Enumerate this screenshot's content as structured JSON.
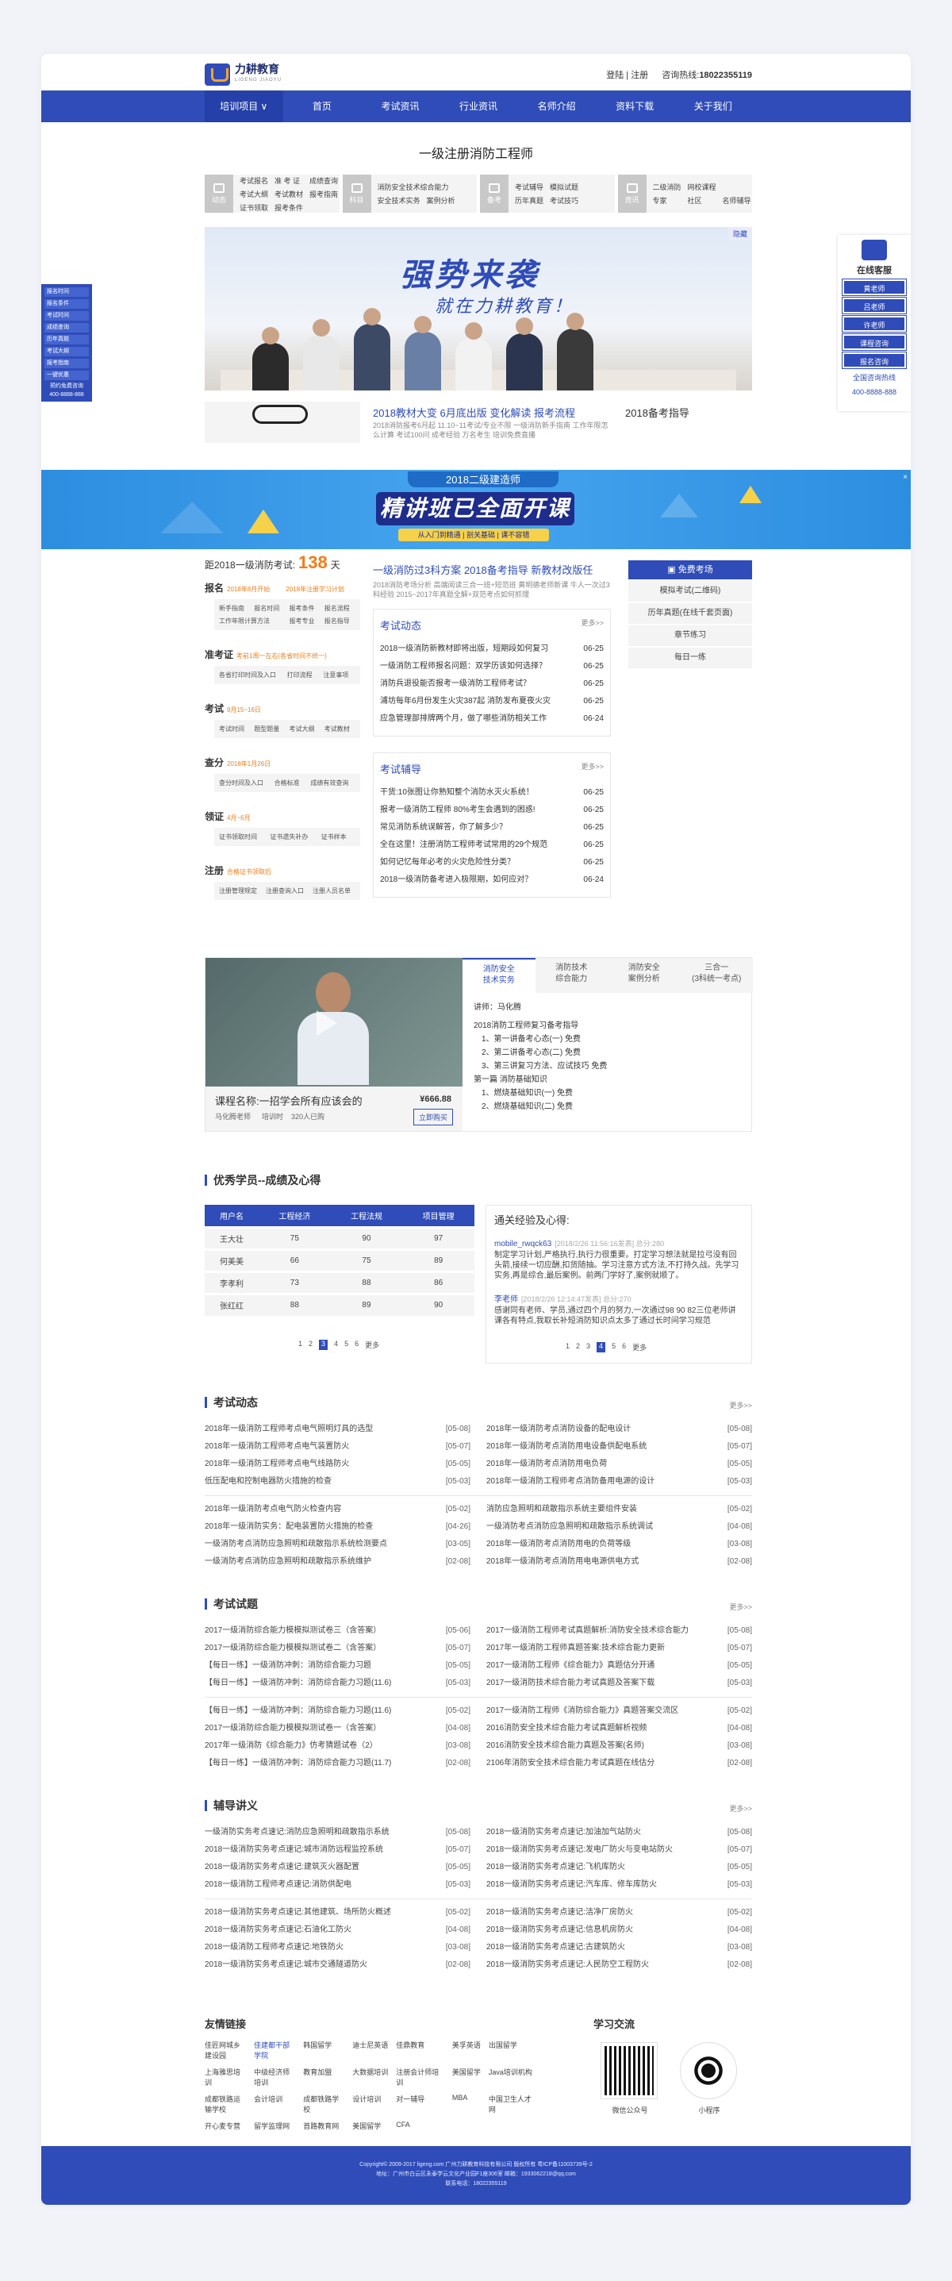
{
  "header": {
    "logo_text": "力耕教育",
    "logo_sub": "LIGENG JIAOYU",
    "login": "登陆",
    "sep": "|",
    "register": "注册",
    "hotline_label": "咨询热线:",
    "hotline": "18022355119"
  },
  "nav": [
    "培训项目 ∨",
    "首页",
    "考试资讯",
    "行业资讯",
    "名师介绍",
    "资料下载",
    "关于我们"
  ],
  "page_title": "一级注册消防工程师",
  "categories": [
    {
      "icon": "动态",
      "links": [
        "考试报名",
        "准 考 证",
        "成绩查询",
        "考试大纲",
        "考试教材",
        "报考指南",
        "证书领取",
        "报考条件"
      ]
    },
    {
      "icon": "科目",
      "links": [
        "消防安全技术综合能力",
        "安全技术实务",
        "案例分析"
      ]
    },
    {
      "icon": "备考",
      "links": [
        "考试辅导",
        "模拟试题",
        "历年真题",
        "考试技巧"
      ]
    },
    {
      "icon": "资讯",
      "links": [
        "二级消防",
        "网校课程",
        "专家",
        "社区",
        "名师辅导"
      ]
    }
  ],
  "hero": {
    "tag": "隐藏",
    "slogan1": "强势来袭",
    "slogan2": "就在力耕教育！"
  },
  "news": {
    "head": "2018教材大变 6月底出版 变化解读 报考流程",
    "sub": "2018消防报考6月起 11.10~11考试/专业不限 一级消防新手指南 工作年限怎么计算 考试100问 成考经验 万名考生 培训免费直播",
    "right_title": "2018备考指导"
  },
  "banner": {
    "top": "2018二级建造师",
    "main": "精讲班已全面开课",
    "sub": "从入门到精通 | 剖关基础 | 课不容错",
    "close": "×"
  },
  "left_float": {
    "items": [
      "报名时间",
      "报名条件",
      "考试时间",
      "成绩查询",
      "历年真题",
      "考试大纲",
      "报考指南",
      "一键优惠"
    ],
    "tel_label": "预约免费咨询",
    "tel": "400-8888-888"
  },
  "right_float": {
    "title": "在线客服",
    "buttons": [
      "黄老师",
      "吕老师",
      "许老师",
      "课程咨询",
      "报名咨询"
    ],
    "tel_label": "全国咨询热线",
    "tel": "400-8888-888"
  },
  "exam": {
    "countdown_prefix": "距2018一级消防考试:",
    "days": "138",
    "days_unit": "天",
    "steps": [
      {
        "title": "报名",
        "date": "2018年8月开始",
        "date2": "2018年注册学习计划",
        "links": [
          "新手指南",
          "报名时间",
          "报考条件",
          "报名流程",
          "工作年限计算方法",
          "报考专业",
          "报名指导"
        ]
      },
      {
        "title": "准考证",
        "date": "考前1周一左右(各省时间不统一)",
        "links": [
          "各省打印时间及入口",
          "打印流程",
          "注意事项"
        ]
      },
      {
        "title": "考试",
        "date": "9月15~16日",
        "links": [
          "考试时间",
          "题型题量",
          "考试大纲",
          "考试教材"
        ]
      },
      {
        "title": "查分",
        "date": "2018年1月26日",
        "links": [
          "查分时间及入口",
          "合格标准",
          "成绩有效查询"
        ]
      },
      {
        "title": "领证",
        "date": "4月~6月",
        "links": [
          "证书领取时间",
          "证书遗失补办",
          "证书样本"
        ]
      },
      {
        "title": "注册",
        "date": "合格证书领取后",
        "links": [
          "注册管理规定",
          "注册查询入口",
          "注册人员名单"
        ]
      }
    ]
  },
  "mid": {
    "head": "一级消防过3科方案 2018备考指导 新教材改版任",
    "sub": "2018消防考场分析 高端阅读三合一班+短范班 黄明德老师新课 牛人一次过3科经验 2015~2017年真题全解+双范考点如何抓理",
    "news_box": {
      "title": "考试动态",
      "more": "更多>>",
      "items": [
        {
          "t": "2018一级消防新教材即将出版，短期段如何复习",
          "d": "06-25"
        },
        {
          "t": "一级消防工程师报名问题：双学历该如何选择？",
          "d": "06-25"
        },
        {
          "t": "消防兵退役能否报考一级消防工程师考试？",
          "d": "06-25"
        },
        {
          "t": "浦坊每年6月份发生火灾387起 消防发布夏夜火灾",
          "d": "06-25"
        },
        {
          "t": "应急管理部排牌两个月，做了哪些消防相关工作",
          "d": "06-24"
        }
      ]
    },
    "coach_box": {
      "title": "考试辅导",
      "more": "更多>>",
      "items": [
        {
          "t": "干货:10张图让你熟知整个消防水灭火系统！",
          "d": "06-25"
        },
        {
          "t": "报考一级消防工程师 80%考生会遇到的困惑!",
          "d": "06-25"
        },
        {
          "t": "常见消防系统误解答，你了解多少？",
          "d": "06-25"
        },
        {
          "t": "全在这里！注册消防工程师考试常用的29个规范",
          "d": "06-25"
        },
        {
          "t": "如何记忆每年必考的火灾危险性分类？",
          "d": "06-25"
        },
        {
          "t": "2018一级消防备考进入极限期，如何应对？",
          "d": "06-24"
        }
      ]
    }
  },
  "right_col": {
    "head": "免费考场",
    "items": [
      "模拟考试(二维码)",
      "历年真题(在线千套页面)",
      "章节练习",
      "每日一练"
    ]
  },
  "course": {
    "name": "课程名称:一招学会所有应该会的",
    "teacher": "马化腾老师",
    "count_label": "培训时",
    "count": "320人已购",
    "price": "¥666.88",
    "buy": "立即购买",
    "tabs": [
      [
        "消防安全",
        "技术实务"
      ],
      [
        "消防技术",
        "综合能力"
      ],
      [
        "消防安全",
        "案例分析"
      ],
      [
        "三合一",
        "(3科统一考点)"
      ]
    ],
    "lecturer": "讲师：马化腾",
    "chapters": [
      "2018消防工程师复习备考指导",
      "1、第一讲备考心态(一) 免费",
      "2、第二讲备考心态(二) 免费",
      "3、第三讲复习方法、应试技巧 免费",
      "第一篇 消防基础知识",
      "1、燃烧基础知识(一) 免费",
      "2、燃烧基础知识(二) 免费"
    ]
  },
  "students": {
    "section": "优秀学员--成绩及心得",
    "headers": [
      "用户名",
      "工程经济",
      "工程法规",
      "项目管理"
    ],
    "rows": [
      [
        "王大壮",
        "75",
        "90",
        "97"
      ],
      [
        "何美美",
        "66",
        "75",
        "89"
      ],
      [
        "李孝利",
        "73",
        "88",
        "86"
      ],
      [
        "张红红",
        "88",
        "89",
        "90"
      ]
    ],
    "pager": [
      "1",
      "2",
      "3",
      "4",
      "5",
      "6",
      "更多"
    ],
    "exp_title": "通关经验及心得:",
    "exps": [
      {
        "user": "mobile_rwqck63",
        "meta": "[2018/2/26 11:56:16发表] 总分:280",
        "text": "制定学习计划,严格执行,执行力很重要。打定学习想法就是拉弓没有回头箭,接续一切应酬,扣货随抽。学习注意方式方法,不打持久战。先学习实务,再是综合,最后案例。前两门学好了,案例就顺了。"
      },
      {
        "user": "李老师",
        "meta": "[2018/2/26 12:14:47发表] 总分:270",
        "text": "感谢同有老师、学员,通过四个月的努力,一次通过98 90 82三位老师讲课各有特点,我取长补短消防知识点太多了通过长时间学习规范"
      }
    ],
    "pager2": [
      "1",
      "2",
      "3",
      "4",
      "5",
      "6",
      "更多"
    ]
  },
  "news_section": {
    "title": "考试动态",
    "more": "更多>>",
    "left": [
      {
        "t": "2018年一级消防工程师考点电气照明灯具的选型",
        "d": "[05-08]"
      },
      {
        "t": "2018年一级消防工程师考点电气装置防火",
        "d": "[05-07]"
      },
      {
        "t": "2018年一级消防工程师考点电气线路防火",
        "d": "[05-05]"
      },
      {
        "t": "低压配电和控制电器防火措施的检查",
        "d": "[05-03]"
      },
      {
        "t": "2018年一级消防考点电气防火检查内容",
        "d": "[05-02]"
      },
      {
        "t": "2018年一级消防实务：配电装置防火措施的检查",
        "d": "[04-26]"
      },
      {
        "t": "一级消防考点消防应急照明和疏散指示系统检测要点",
        "d": "[03-05]"
      },
      {
        "t": "一级消防考点消防应急照明和疏散指示系统维护",
        "d": "[02-08]"
      }
    ],
    "right": [
      {
        "t": "2018年一级消防考点消防设备的配电设计",
        "d": "[05-08]"
      },
      {
        "t": "2018年一级消防考点消防用电设备供配电系统",
        "d": "[05-07]"
      },
      {
        "t": "2018年一级消防考点消防用电负荷",
        "d": "[05-05]"
      },
      {
        "t": "2018年一级消防工程师考点消防备用电源的设计",
        "d": "[05-03]"
      },
      {
        "t": "消防应急照明和疏散指示系统主要组件安装",
        "d": "[05-02]"
      },
      {
        "t": "一级消防考点消防应急照明和疏散指示系统调试",
        "d": "[04-08]"
      },
      {
        "t": "2018年一级消防考点消防用电的负荷等级",
        "d": "[03-08]"
      },
      {
        "t": "2018年一级消防考点消防用电电源供电方式",
        "d": "[02-08]"
      }
    ]
  },
  "test_section": {
    "title": "考试试题",
    "more": "更多>>",
    "left": [
      {
        "t": "2017一级消防综合能力模模拟测试卷三（含答案）",
        "d": "[05-06]"
      },
      {
        "t": "2017一级消防综合能力模模拟测试卷二（含答案）",
        "d": "[05-07]"
      },
      {
        "t": "【每日一练】一级消防冲刺：消防综合能力习题",
        "d": "[05-05]"
      },
      {
        "t": "【每日一练】一级消防冲刺：消防综合能力习题(11.6)",
        "d": "[05-03]"
      },
      {
        "t": "【每日一练】一级消防冲刺：消防综合能力习题(11.6)",
        "d": "[05-02]"
      },
      {
        "t": "2017一级消防综合能力模模拟测试卷一（含答案）",
        "d": "[04-08]"
      },
      {
        "t": "2017年一级消防《综合能力》仿考猜题试卷（2）",
        "d": "[03-08]"
      },
      {
        "t": "【每日一练】一级消防冲刺：消防综合能力习题(11.7)",
        "d": "[02-08]"
      }
    ],
    "right": [
      {
        "t": "2017一级消防工程师考试真题解析:消防安全技术综合能力",
        "d": "[05-08]"
      },
      {
        "t": "2017年一级消防工程师真题答案:技术综合能力更新",
        "d": "[05-07]"
      },
      {
        "t": "2017一级消防工程师《综合能力》真题估分开通",
        "d": "[05-05]"
      },
      {
        "t": "2017一级消防技术综合能力考试真题及答案下载",
        "d": "[05-03]"
      },
      {
        "t": "2017一级消防工程师《消防综合能力》真题答案交流区",
        "d": "[05-02]"
      },
      {
        "t": "2016消防安全技术综合能力考试真题解析视频",
        "d": "[04-08]"
      },
      {
        "t": "2016消防安全技术综合能力真题及答案(名师)",
        "d": "[03-08]"
      },
      {
        "t": "2106年消防安全技术综合能力考试真题在线估分",
        "d": "[02-08]"
      }
    ]
  },
  "lecture_section": {
    "title": "辅导讲义",
    "more": "更多>>",
    "left": [
      {
        "t": "一级消防实务考点速记:消防应急照明和疏散指示系统",
        "d": "[05-08]"
      },
      {
        "t": "2018一级消防实务考点速记:城市消防远程监控系统",
        "d": "[05-07]"
      },
      {
        "t": "2018一级消防实务考点速记:建筑灭火器配置",
        "d": "[05-05]"
      },
      {
        "t": "2018一级消防工程师考点速记:消防供配电",
        "d": "[05-03]"
      },
      {
        "t": "2018一级消防实务考点速记:其他建筑、场所防火概述",
        "d": "[05-02]"
      },
      {
        "t": "2018一级消防实务考点速记:石油化工防火",
        "d": "[04-08]"
      },
      {
        "t": "2018一级消防工程师考点速记:地铁防火",
        "d": "[03-08]"
      },
      {
        "t": "2018一级消防实务考点速记:城市交通隧道防火",
        "d": "[02-08]"
      }
    ],
    "right": [
      {
        "t": "2018一级消防实务考点速记:加油加气站防火",
        "d": "[05-08]"
      },
      {
        "t": "2018一级消防实务考点速记:发电厂防火与变电站防火",
        "d": "[05-07]"
      },
      {
        "t": "2018一级消防实务考点速记:飞机库防火",
        "d": "[05-05]"
      },
      {
        "t": "2018一级消防实务考点速记:汽车库、修车库防火",
        "d": "[05-03]"
      },
      {
        "t": "2018一级消防实务考点速记:洁净厂房防火",
        "d": "[05-02]"
      },
      {
        "t": "2018一级消防实务考点速记:信息机房防火",
        "d": "[04-08]"
      },
      {
        "t": "2018一级消防实务考点速记:古建筑防火",
        "d": "[03-08]"
      },
      {
        "t": "2018一级消防实务考点速记:人民防空工程防火",
        "d": "[02-08]"
      }
    ]
  },
  "friends": {
    "title": "友情链接",
    "links": [
      "佳匠网城乡建设园",
      "佳建都干部学院",
      "韩国留学",
      "迪士尼英语",
      "佳鼎教育",
      "美孚英语",
      "出国留学",
      "上海雅思培训",
      "中级经济师培训",
      "教育加盟",
      "大数据培训",
      "注册会计师培训",
      "美国留学",
      "Java培训机构",
      "成都铁路运输学校",
      "会计培训",
      "成都铁路学校",
      "设计培训",
      "对一辅导",
      "MBA",
      "中国卫生人才网",
      "开心麦专营",
      "留学监理网",
      "首路教育网",
      "美国留学",
      "CFA"
    ],
    "qr_title": "学习交流",
    "qr1": "微信公众号",
    "qr2": "小程序"
  },
  "footer": {
    "line1": "Copyright© 2009-2017 ligeng.com 广州力耕教育科技有限公司 版权所有 粤ICP备11003739号-2",
    "line2": "地址：广州市白云区永泰学云文化产业园F1座306室 邮箱：1933062218@qq.com",
    "line3": "联系电话：18022355119"
  }
}
